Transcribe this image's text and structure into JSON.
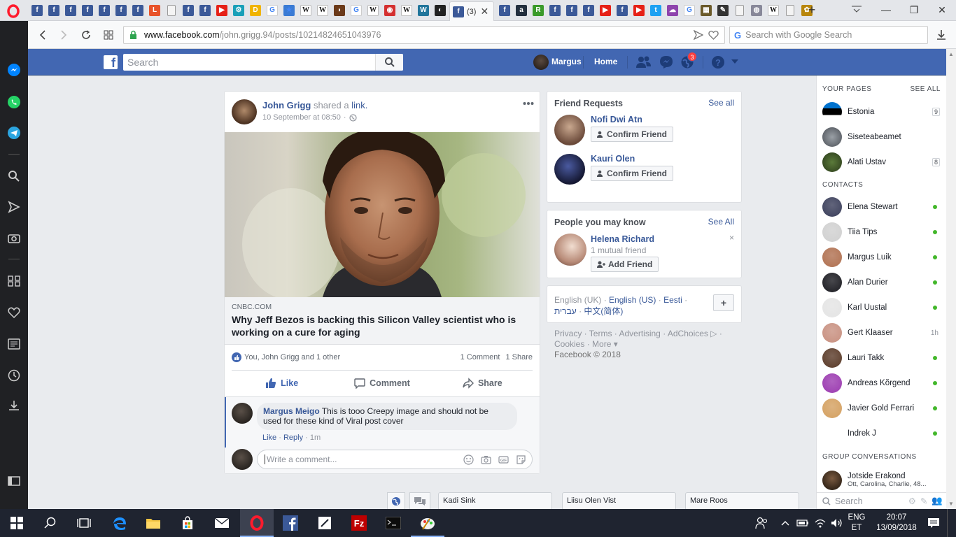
{
  "browser": {
    "tab_count": "(3)",
    "url_domain": "www.facebook.com",
    "url_path": "/john.grigg.94/posts/10214824651043976",
    "search_placeholder": "Search with Google Search"
  },
  "fb_header": {
    "search_placeholder": "Search",
    "user_name": "Margus",
    "home_label": "Home",
    "notification_count": "3"
  },
  "post": {
    "author": "John Grigg",
    "action": "shared a",
    "action_link": "link.",
    "timestamp": "10 September at 08:50",
    "link_source": "CNBC.COM",
    "link_title": "Why Jeff Bezos is backing this Silicon Valley scientist who is working on a cure for aging",
    "reactions_text": "You, John Grigg and 1 other",
    "comments_count": "1 Comment",
    "shares_count": "1 Share",
    "like_label": "Like",
    "comment_label": "Comment",
    "share_label": "Share",
    "comment": {
      "author": "Margus Meigo",
      "text": "This is tooo Creepy image and should not be used for these kind of Viral post cover",
      "like": "Like",
      "reply": "Reply",
      "time": "1m"
    },
    "comment_placeholder": "Write a comment..."
  },
  "friend_requests": {
    "title": "Friend Requests",
    "see_all": "See all",
    "confirm_label": "Confirm Friend",
    "items": [
      {
        "name": "Nofi Dwi Atn"
      },
      {
        "name": "Kauri Olen"
      }
    ]
  },
  "pymk": {
    "title": "People you may know",
    "see_all": "See All",
    "name": "Helena Richard",
    "mutual": "1 mutual friend",
    "add_label": "Add Friend"
  },
  "languages": {
    "current": "English (UK)",
    "others": [
      "English (US)",
      "Eesti",
      "עברית",
      "中文(简体)"
    ],
    "add": "+"
  },
  "footer": {
    "links": [
      "Privacy",
      "Terms",
      "Advertising",
      "AdChoices",
      "Cookies",
      "More"
    ],
    "copyright": "Facebook © 2018"
  },
  "sidebar": {
    "pages_header": "YOUR PAGES",
    "see_all": "SEE ALL",
    "pages": [
      {
        "name": "Estonia",
        "badge": "9"
      },
      {
        "name": "Siseteabeamet",
        "badge": ""
      },
      {
        "name": "Alati Ustav",
        "badge": "8"
      }
    ],
    "contacts_header": "CONTACTS",
    "contacts": [
      {
        "name": "Elena Stewart",
        "status": ""
      },
      {
        "name": "Tiia Tips",
        "status": ""
      },
      {
        "name": "Margus Luik",
        "status": ""
      },
      {
        "name": "Alan Durier",
        "status": ""
      },
      {
        "name": "Karl Uustal",
        "status": ""
      },
      {
        "name": "Gert Klaaser",
        "status": "1h"
      },
      {
        "name": "Lauri Takk",
        "status": ""
      },
      {
        "name": "Andreas Kõrgend",
        "status": ""
      },
      {
        "name": "Javier Gold Ferrari",
        "status": ""
      },
      {
        "name": "Indrek J",
        "status": ""
      }
    ],
    "group_header": "GROUP CONVERSATIONS",
    "group": {
      "name": "Jotside Erakond",
      "members": "Ott, Carolina, Charlie, 48..."
    },
    "search_placeholder": "Search"
  },
  "chat_tabs": [
    "Kadi Sink",
    "Liisu Olen Vist",
    "Mare Roos"
  ],
  "taskbar": {
    "lang_top": "ENG",
    "lang_bottom": "ET",
    "time": "20:07",
    "date": "13/09/2018"
  },
  "colors": {
    "fb_blue": "#4267b2",
    "link_blue": "#385898",
    "online_green": "#42b72a",
    "opera_red": "#ff1b2d"
  }
}
